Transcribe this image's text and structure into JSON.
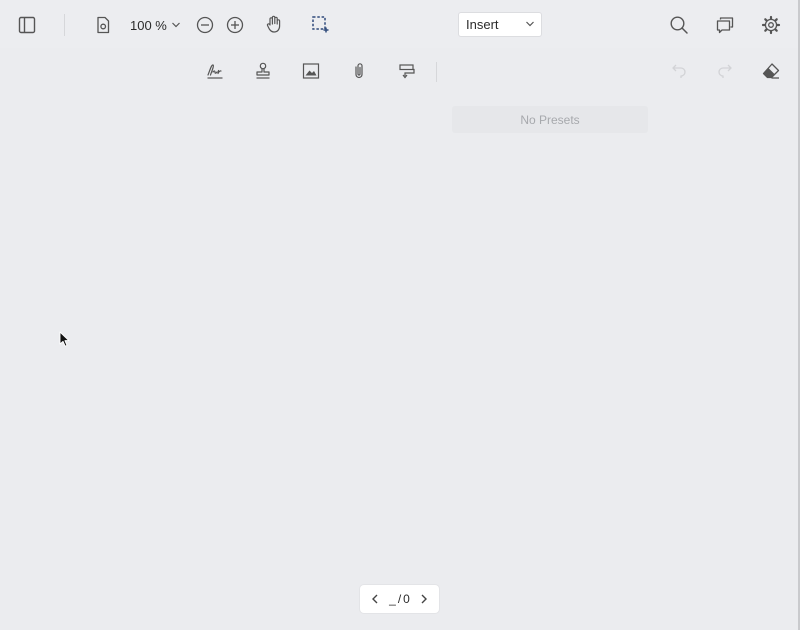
{
  "toolbar": {
    "zoom_label": "100 %",
    "mode_select": {
      "selected": "Insert"
    },
    "icons": {
      "sidebar": "sidebar-toggle-icon",
      "doc_settings": "document-settings-icon",
      "zoom_out": "zoom-out-icon",
      "zoom_in": "zoom-in-icon",
      "pan": "hand-pan-icon",
      "marquee": "marquee-zoom-icon",
      "search": "search-icon",
      "comments": "comments-icon",
      "settings": "gear-icon"
    }
  },
  "insert_toolbar": {
    "tools": [
      "signature-icon",
      "stamp-icon",
      "image-icon",
      "attachment-icon",
      "callout-icon"
    ],
    "presets_label": "No Presets",
    "undo_enabled": false,
    "redo_enabled": false,
    "eraser": "eraser-icon"
  },
  "page_nav": {
    "current": "_",
    "separator": "/",
    "total": "0"
  },
  "colors": {
    "background": "#ebecef",
    "icon": "#555555",
    "accent": "#2f4a7a",
    "disabled": "#d2d3d6"
  }
}
